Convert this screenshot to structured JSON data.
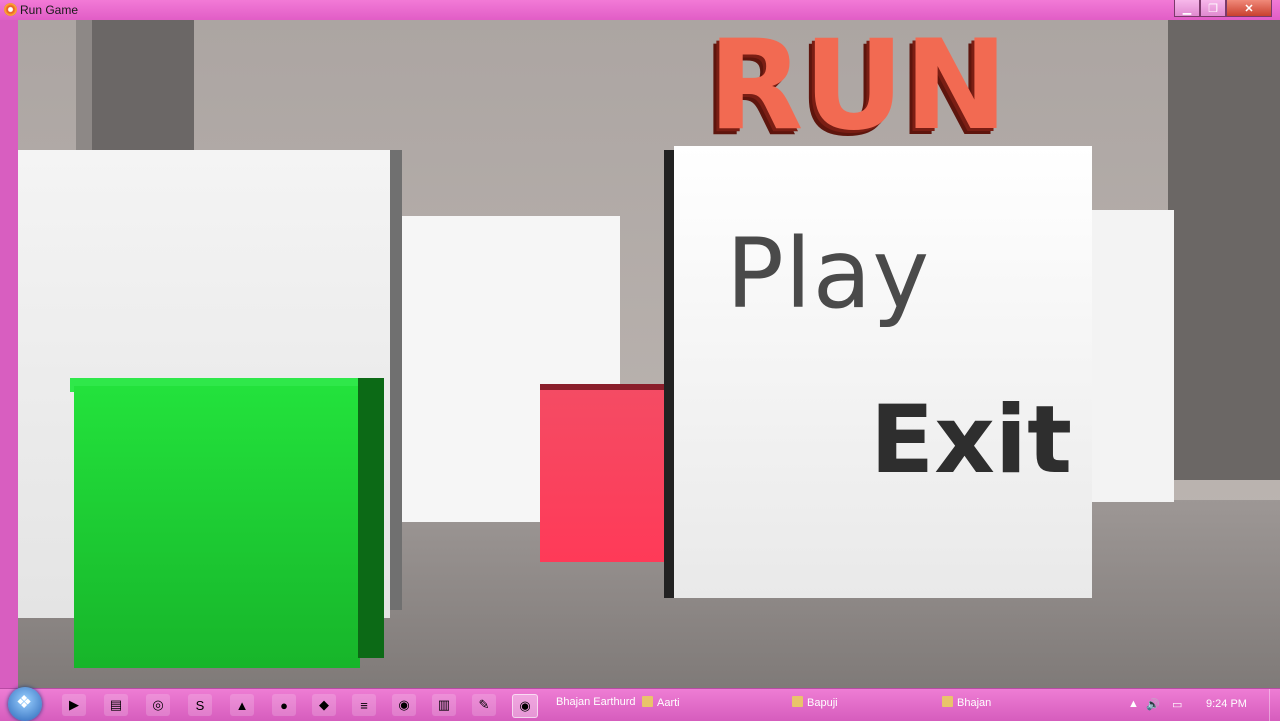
{
  "window": {
    "title": "Run Game",
    "minimize": "▁",
    "maximize": "❐",
    "close": "✕"
  },
  "game": {
    "title": "RUN",
    "menu": {
      "play": "Play",
      "exit": "Exit"
    }
  },
  "taskbar": {
    "tasks": [
      "Bhajan Earthurd",
      "Aarti",
      "Bapuji",
      "Bhajan"
    ],
    "tray": {
      "expand": "▲",
      "volume": "🔊",
      "network": "▭"
    },
    "clock": "9:24 PM"
  }
}
